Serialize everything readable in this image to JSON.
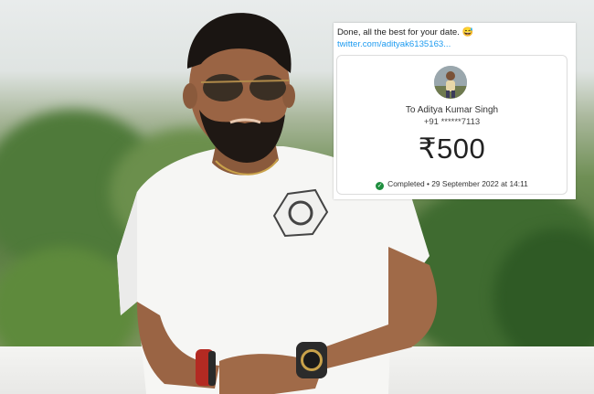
{
  "tweet": {
    "text": "Done, all the best for your date.",
    "emoji": "😅",
    "link": "twitter.com/adityak6135163..."
  },
  "payment": {
    "payee": "To Aditya Kumar Singh",
    "phone": "+91 ******7113",
    "amount": "₹500",
    "status": "Completed • 29 September 2022 at 14:11",
    "status_icon": "check-circle-icon",
    "status_color": "#1e8e3e"
  },
  "colors": {
    "link": "#1d9bf0",
    "card_background": "#ffffff"
  }
}
